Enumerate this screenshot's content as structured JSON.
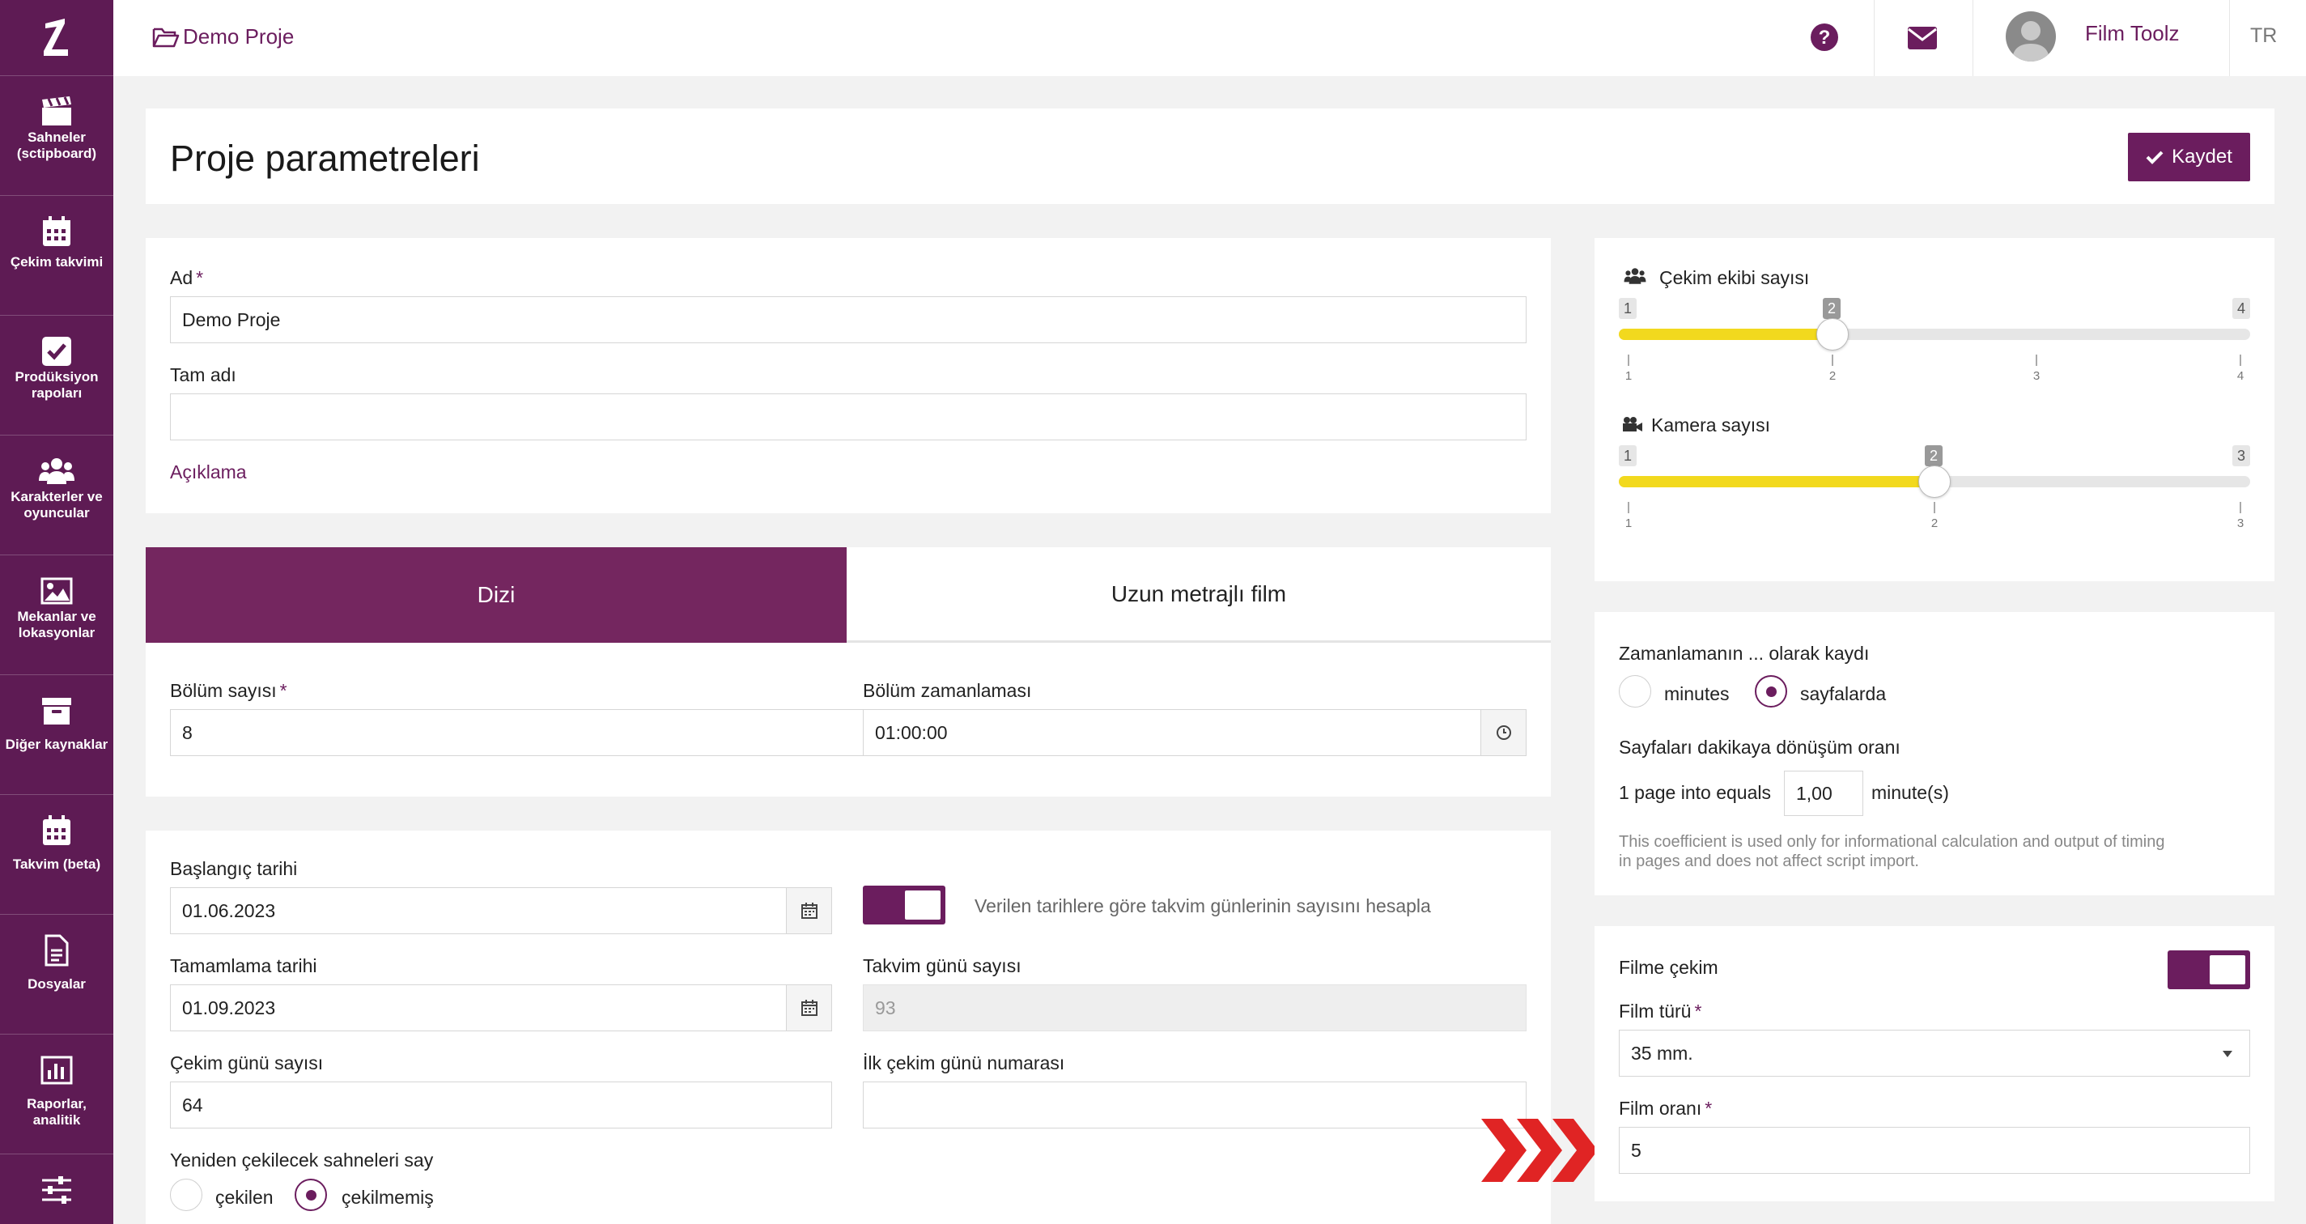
{
  "sidebar": {
    "items": [
      {
        "label": "Sahneler (sctipboard)",
        "icon": "clapperboard-icon"
      },
      {
        "label": "Çekim takvimi",
        "icon": "calendar-icon"
      },
      {
        "label": "Prodüksiyon rapoları",
        "icon": "checkbox-icon"
      },
      {
        "label": "Karakterler ve oyuncular",
        "icon": "users-icon"
      },
      {
        "label": "Mekanlar ve lokasyonlar",
        "icon": "image-icon"
      },
      {
        "label": "Diğer kaynaklar",
        "icon": "archive-icon"
      },
      {
        "label": "Takvim (beta)",
        "icon": "calendar-beta-icon"
      },
      {
        "label": "Dosyalar",
        "icon": "file-icon"
      },
      {
        "label": "Raporlar, analitik",
        "icon": "bar-chart-icon"
      },
      {
        "label": "",
        "icon": "sliders-icon"
      }
    ]
  },
  "header": {
    "breadcrumb": "Demo Proje",
    "user_name": "Film Toolz",
    "language": "TR"
  },
  "page": {
    "title": "Proje parametreleri",
    "save_label": "Kaydet"
  },
  "project": {
    "name_label": "Ad",
    "name_value": "Demo Proje",
    "fullname_label": "Tam adı",
    "fullname_value": "",
    "description_link": "Açıklama"
  },
  "tabs": {
    "series": "Dizi",
    "feature": "Uzun metrajlı film",
    "active": "series"
  },
  "episodes": {
    "count_label": "Bölüm sayısı",
    "count_value": "8",
    "timing_label": "Bölüm zamanlaması",
    "timing_value": "01:00:00"
  },
  "dates": {
    "start_label": "Başlangıç tarihi",
    "start_value": "01.06.2023",
    "calc_toggle_label": "Verilen tarihlere göre takvim günlerinin sayısını hesapla",
    "calc_toggle_on": true,
    "end_label": "Tamamlama tarihi",
    "end_value": "01.09.2023",
    "calendar_days_label": "Takvim günü sayısı",
    "calendar_days_value": "93",
    "shoot_days_label": "Çekim günü sayısı",
    "shoot_days_value": "64",
    "first_day_label": "İlk çekim günü numarası",
    "first_day_value": "",
    "reshoot_label": "Yeniden çekilecek sahneleri say",
    "reshoot_opt1": "çekilen",
    "reshoot_opt2": "çekilmemiş",
    "reshoot_selected": "çekilmemiş"
  },
  "crew": {
    "crew_label": "Çekim ekibi sayısı",
    "crew_min": 1,
    "crew_max": 4,
    "crew_value": 2,
    "crew_ticks": [
      "1",
      "2",
      "3",
      "4"
    ],
    "camera_label": "Kamera sayısı",
    "camera_min": 1,
    "camera_max": 3,
    "camera_value": 2,
    "camera_ticks": [
      "1",
      "2",
      "3"
    ]
  },
  "timing": {
    "recorded_label": "Zamanlamanın ... olarak kaydı",
    "opt_minutes": "minutes",
    "opt_pages": "sayfalarda",
    "selected": "sayfalarda",
    "ratio_label": "Sayfaları dakikaya dönüşüm oranı",
    "ratio_prefix": "1 page into equals",
    "ratio_value": "1,00",
    "ratio_suffix": "minute(s)",
    "note_line1": "This coefficient is used only for informational calculation and output of timing",
    "note_line2": "in pages and does not affect script import."
  },
  "film": {
    "shoot_label": "Filme çekim",
    "shoot_on": true,
    "type_label": "Film türü",
    "type_value": "35 mm.",
    "ratio_label": "Film oranı",
    "ratio_value": "5"
  },
  "colors": {
    "brand_purple": "#6b1d5e",
    "slider_yellow": "#f2d91e",
    "arrow_red": "#e02424"
  }
}
